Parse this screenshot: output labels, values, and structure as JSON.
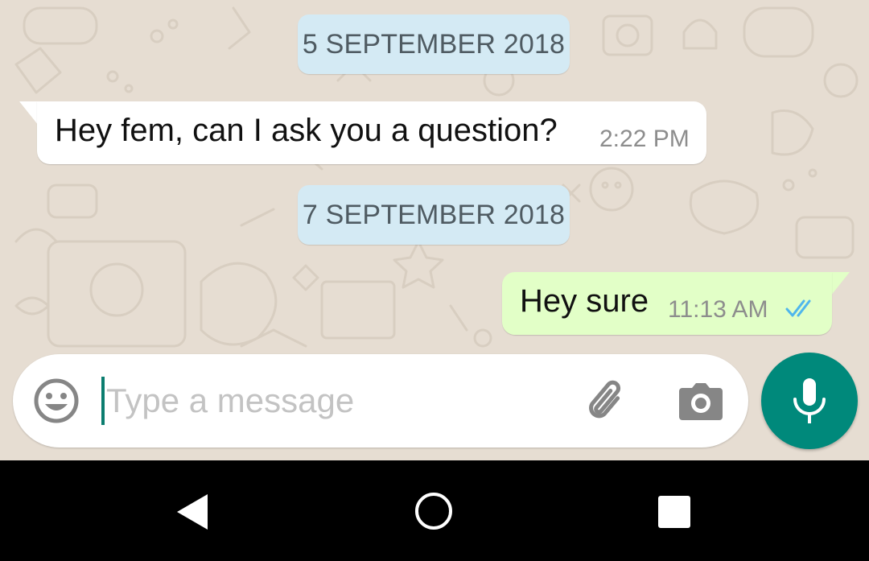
{
  "chat": {
    "date_separators": [
      "5 SEPTEMBER 2018",
      "7 SEPTEMBER 2018"
    ],
    "messages": [
      {
        "direction": "incoming",
        "text": "Hey fem, can I ask you a question?",
        "time": "2:22 PM"
      },
      {
        "direction": "outgoing",
        "text": "Hey sure",
        "time": "11:13 AM",
        "status": "read",
        "status_icon": "double-check-icon"
      }
    ],
    "background_color": "#e6ddd2"
  },
  "composer": {
    "placeholder": "Type a message",
    "value": "",
    "icons": [
      "emoji-icon",
      "paperclip-icon",
      "camera-icon"
    ]
  },
  "mic_button": {
    "icon": "microphone-icon",
    "color": "#00897b"
  },
  "navbar": {
    "icons": [
      "back-triangle-icon",
      "home-circle-icon",
      "recents-square-icon"
    ]
  },
  "colors": {
    "incoming_bubble": "#ffffff",
    "outgoing_bubble": "#e2ffc7",
    "date_chip": "#d4eaf4",
    "read_ticks": "#4fb6ec",
    "accent": "#00897b"
  }
}
